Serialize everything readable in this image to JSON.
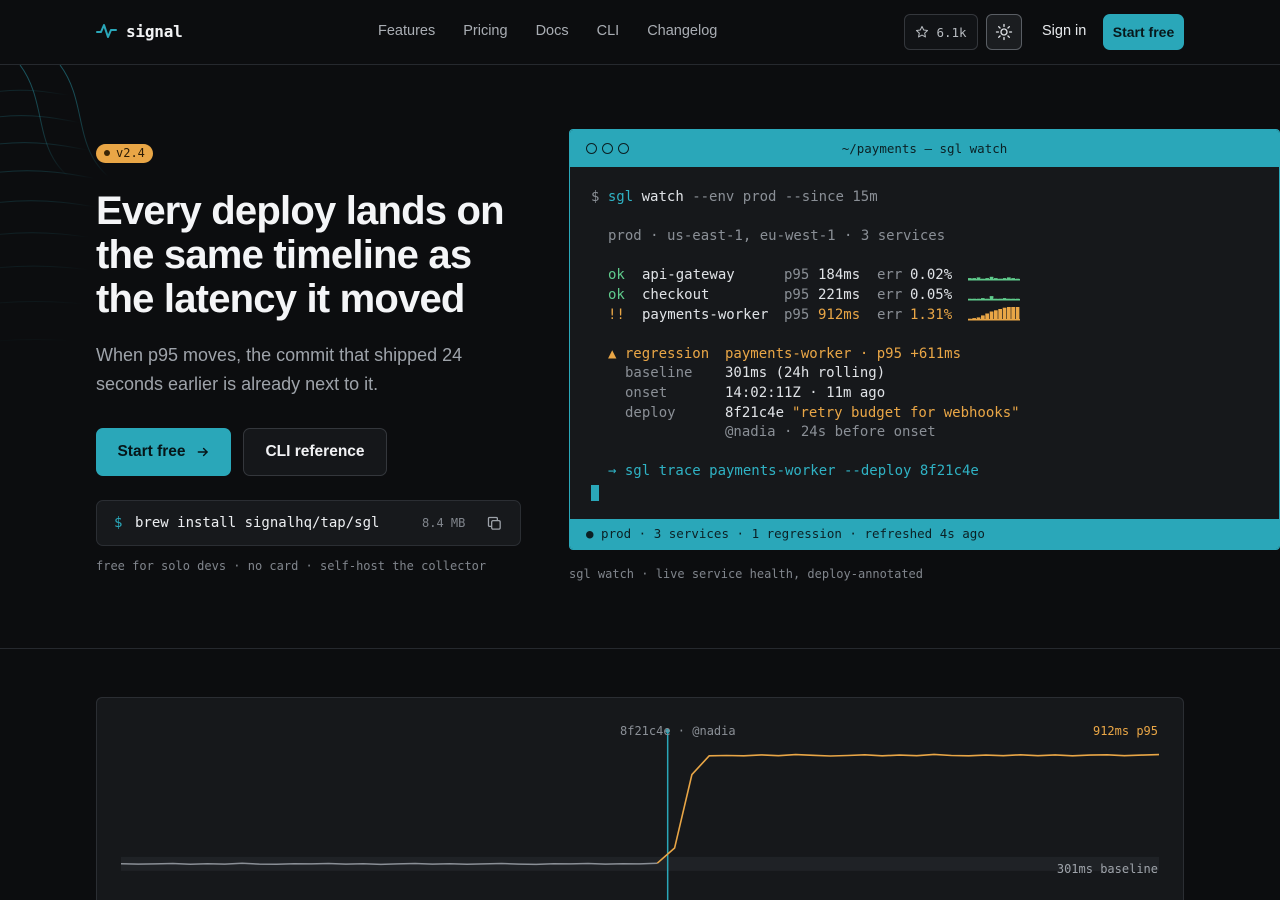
{
  "brand": {
    "name": "signal",
    "accent": "#2aa7b9",
    "warn": "#e9a646",
    "ok": "#5fcb8c"
  },
  "nav": {
    "links": [
      "Features",
      "Pricing",
      "Docs",
      "CLI",
      "Changelog"
    ],
    "stars": "6.1k",
    "signin": "Sign in",
    "start": "Start free"
  },
  "hero": {
    "version": "v2.4",
    "headline": "Every deploy lands on the same timeline as the latency it moved",
    "sub": "When p95 moves, the commit that shipped 24 seconds earlier is already next to it.",
    "primary_cta": "Start free",
    "secondary_cta": "CLI reference",
    "install": {
      "prompt": "$",
      "command": "brew install signalhq/tap/sgl",
      "size": "8.4 MB"
    },
    "fineprint": "free for solo devs · no card · self-host the collector"
  },
  "terminal": {
    "title": "~/payments — sgl watch",
    "prompt": "$",
    "cmd_bin": "sgl",
    "cmd_sub": "watch",
    "cmd_args": "--env prod --since 15m",
    "context": "prod · us-east-1, eu-west-1 · 3 services",
    "services": [
      {
        "status": "ok",
        "name": "api-gateway",
        "p95": "184ms",
        "err": "0.02%",
        "spark": [
          0.15,
          0.15,
          0.2,
          0.1,
          0.15,
          0.25,
          0.15,
          0.1,
          0.15,
          0.2,
          0.15,
          0.1
        ]
      },
      {
        "status": "ok",
        "name": "checkout",
        "p95": "221ms",
        "err": "0.05%",
        "spark": [
          0.1,
          0.1,
          0.1,
          0.15,
          0.1,
          0.3,
          0.1,
          0.1,
          0.15,
          0.1,
          0.1,
          0.1
        ]
      },
      {
        "status": "!!",
        "name": "payments-worker",
        "p95": "912ms",
        "err": "1.31%",
        "spark": [
          0.1,
          0.15,
          0.2,
          0.35,
          0.5,
          0.65,
          0.75,
          0.85,
          0.95,
          1,
          1,
          1
        ]
      }
    ],
    "labels": {
      "p95": "p95",
      "err": "err"
    },
    "regression": {
      "marker": "▲ regression",
      "target": "payments-worker · p95 +611ms",
      "baseline_label": "baseline",
      "baseline": "301ms (24h rolling)",
      "onset_label": "onset",
      "onset": "14:02:11Z · 11m ago",
      "deploy_label": "deploy",
      "deploy_sha": "8f21c4e",
      "deploy_msg": "\"retry budget for webhooks\"",
      "deploy_meta": "@nadia · 24s before onset"
    },
    "suggest": "→ sgl trace payments-worker --deploy 8f21c4e",
    "status": "● prod · 3 services · 1 regression · refreshed 4s ago"
  },
  "caption": "sgl watch · live service health, deploy-annotated",
  "chart_data": {
    "type": "line",
    "deploy_label": "8f21c4e · @nadia",
    "series": [
      {
        "name": "p95",
        "values": [
          302,
          300,
          301,
          303,
          299,
          302,
          300,
          304,
          300,
          299,
          302,
          301,
          303,
          300,
          302,
          298,
          301,
          303,
          300,
          302,
          299,
          301,
          303,
          300,
          298,
          302,
          301,
          303,
          300,
          302,
          301,
          305,
          390,
          800,
          905,
          907,
          905,
          910,
          906,
          912,
          908,
          904,
          907,
          911,
          905,
          909,
          906,
          913,
          907,
          905,
          909,
          906,
          911,
          906,
          910,
          905,
          909,
          911,
          906,
          909,
          912
        ]
      }
    ],
    "deploy_index": 31,
    "end_label": "912ms p95",
    "baseline_label": "301ms baseline",
    "baseline_value": 301,
    "ylim": [
      250,
      960
    ]
  }
}
